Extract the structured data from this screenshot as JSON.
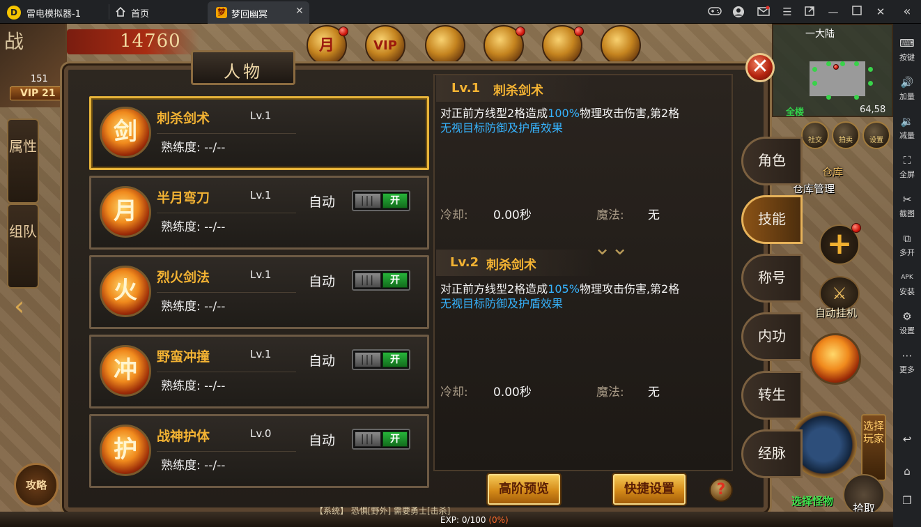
{
  "window": {
    "app_title": "雷电模拟器-1",
    "home_tab": "首页",
    "game_tab": "梦回幽冥",
    "logo_letter": "D"
  },
  "titlebar_icons": [
    "gamepad-icon",
    "user-icon",
    "mail-icon",
    "menu-icon",
    "popout-icon",
    "minimize-icon",
    "maximize-icon",
    "close-icon",
    "collapse-icon"
  ],
  "sidebar": {
    "items": [
      {
        "icon": "keyboard-icon",
        "label": "按键"
      },
      {
        "icon": "volume-up-icon",
        "label": "加量"
      },
      {
        "icon": "volume-down-icon",
        "label": "减量"
      },
      {
        "icon": "fullscreen-icon",
        "label": "全屏"
      },
      {
        "icon": "scissors-icon",
        "label": "截图"
      },
      {
        "icon": "multi-open-icon",
        "label": "多开"
      },
      {
        "icon": "apk-icon",
        "label": "安装"
      },
      {
        "icon": "gear-icon",
        "label": "设置"
      },
      {
        "icon": "more-icon",
        "label": "更多"
      }
    ],
    "apk_glyph": "APK"
  },
  "hud": {
    "class_char": "战",
    "level": "151",
    "vip": "VIP 21",
    "power": "14760",
    "top_icons": [
      "月",
      "VIP",
      "",
      "",
      "",
      ""
    ]
  },
  "minimap": {
    "title": "一大陆",
    "all_label": "全楼",
    "coords": "64,58"
  },
  "right_hud": {
    "social": "社交",
    "auction": "拍卖",
    "settings": "设置",
    "warehouse": "仓库",
    "warehouse_manage": "仓库管理",
    "auto_hang": "自动挂机",
    "select_player": "选择玩家",
    "select_monster": "选择怪物",
    "pickup": "拾取",
    "strategy": "攻略"
  },
  "left_tabs": [
    "属性",
    "组队"
  ],
  "panel": {
    "title": "人物",
    "close_glyph": "✕",
    "skills": [
      {
        "name": "刺杀剑术",
        "level": "Lv.1",
        "proficiency_label": "熟练度:",
        "proficiency": "--/--",
        "auto_label": "",
        "toggle": "",
        "selected": true,
        "glyph": "剑"
      },
      {
        "name": "半月弯刀",
        "level": "Lv.1",
        "proficiency_label": "熟练度:",
        "proficiency": "--/--",
        "auto_label": "自动",
        "toggle": "开",
        "knob": "|||",
        "selected": false,
        "glyph": "月"
      },
      {
        "name": "烈火剑法",
        "level": "Lv.1",
        "proficiency_label": "熟练度:",
        "proficiency": "--/--",
        "auto_label": "自动",
        "toggle": "开",
        "knob": "|||",
        "selected": false,
        "glyph": "火"
      },
      {
        "name": "野蛮冲撞",
        "level": "Lv.1",
        "proficiency_label": "熟练度:",
        "proficiency": "--/--",
        "auto_label": "自动",
        "toggle": "开",
        "knob": "|||",
        "selected": false,
        "glyph": "冲"
      },
      {
        "name": "战神护体",
        "level": "Lv.0",
        "proficiency_label": "熟练度:",
        "proficiency": "--/--",
        "auto_label": "自动",
        "toggle": "开",
        "knob": "|||",
        "selected": false,
        "glyph": "护"
      }
    ],
    "detail": {
      "current": {
        "header_level": "Lv.1",
        "header_name": "刺杀剑术",
        "desc_pre": "对正前方线型2格造成",
        "desc_pct": "100%",
        "desc_post": "物理攻击伤害,第2格",
        "desc_line2": "无视目标防御及护盾效果",
        "cooldown_label": "冷却:",
        "cooldown_value": "0.00秒",
        "mana_label": "魔法:",
        "mana_value": "无"
      },
      "next": {
        "header_level": "Lv.2",
        "header_name": "刺杀剑术",
        "desc_pre": "对正前方线型2格造成",
        "desc_pct": "105%",
        "desc_post": "物理攻击伤害,第2格",
        "desc_line2": "无视目标防御及护盾效果",
        "cooldown_label": "冷却:",
        "cooldown_value": "0.00秒",
        "mana_label": "魔法:",
        "mana_value": "无"
      },
      "chevron": "⌄⌄",
      "advanced_preview_btn": "高阶预览",
      "quick_settings_btn": "快捷设置",
      "help_glyph": "?"
    },
    "right_tabs": [
      {
        "label": "角色",
        "active": false
      },
      {
        "label": "技能",
        "active": true
      },
      {
        "label": "称号",
        "active": false
      },
      {
        "label": "内功",
        "active": false
      },
      {
        "label": "转生",
        "active": false
      },
      {
        "label": "经脉",
        "active": false
      }
    ]
  },
  "bottom": {
    "exp_label": "EXP: 0/100",
    "exp_pct": "(0%)",
    "chat": "【系统】 恐惧[野外] 需要勇士[击杀]"
  },
  "colors": {
    "accent_gold": "#f2b233",
    "highlight_blue": "#36b4ff",
    "toggle_green": "#27b43a"
  }
}
